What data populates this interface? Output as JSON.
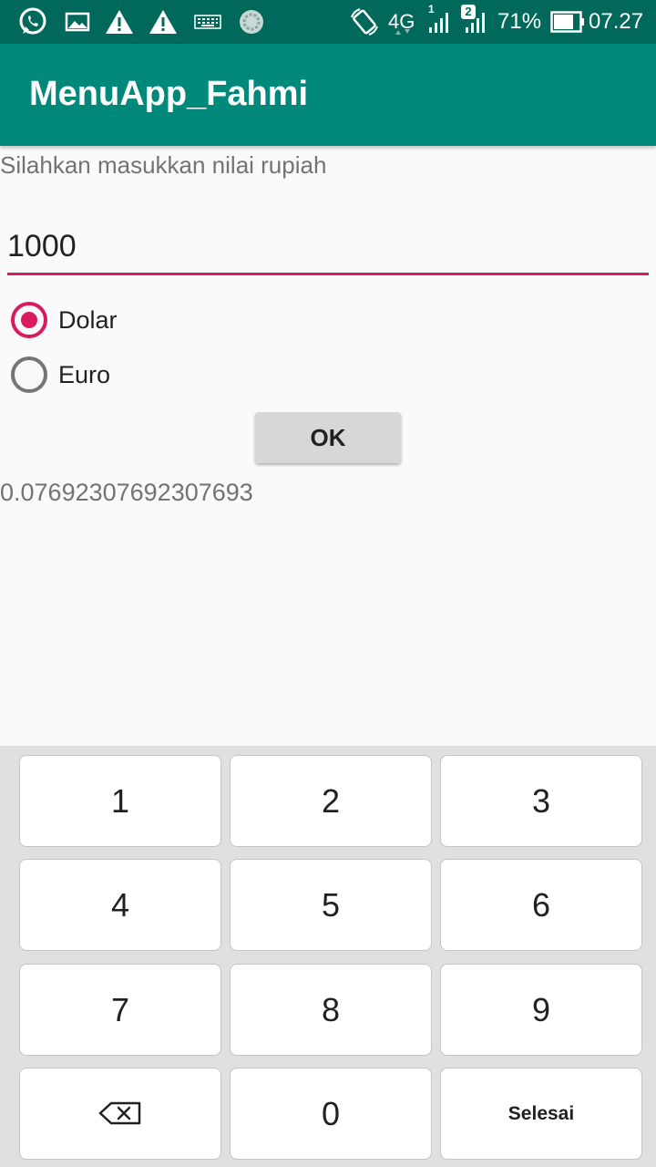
{
  "status_bar": {
    "network": "4G",
    "sim2_badge": "2",
    "sim1_badge": "1",
    "battery": "71%",
    "time": "07.27",
    "icons": [
      "whatsapp-icon",
      "image-icon",
      "warning-icon",
      "warning-icon",
      "keyboard-icon",
      "sync-icon",
      "rotate-icon",
      "signal-icon",
      "signal-icon",
      "battery-icon"
    ]
  },
  "app_bar": {
    "title": "MenuApp_Fahmi"
  },
  "form": {
    "prompt": "Silahkan masukkan nilai rupiah",
    "amount_value": "1000",
    "options": [
      {
        "label": "Dolar",
        "checked": true
      },
      {
        "label": "Euro",
        "checked": false
      }
    ],
    "ok_label": "OK",
    "result": "0.07692307692307693"
  },
  "keyboard": {
    "keys": [
      "1",
      "2",
      "3",
      "4",
      "5",
      "6",
      "7",
      "8",
      "9",
      "",
      "0",
      "Selesai"
    ],
    "backspace_icon": "backspace-icon"
  },
  "colors": {
    "status_bar": "#00695c",
    "app_bar": "#00897b",
    "accent": "#d81b60"
  }
}
